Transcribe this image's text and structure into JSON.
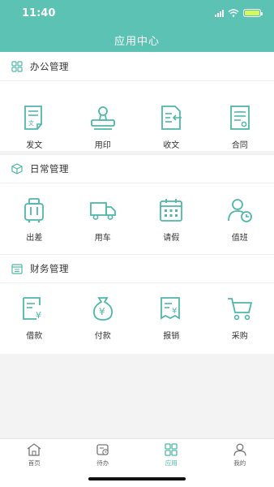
{
  "status_bar": {
    "time": "11:40"
  },
  "header": {
    "title": "应用中心"
  },
  "colors": {
    "accent": "#5bc2b4",
    "icon": "#4fb7a9",
    "battery": "#d7f75a"
  },
  "sections": [
    {
      "title": "办公管理",
      "icon": "grid-icon",
      "items": [
        {
          "label": "发文",
          "icon": "document-icon"
        },
        {
          "label": "用印",
          "icon": "stamp-icon"
        },
        {
          "label": "收文",
          "icon": "receive-document-icon"
        },
        {
          "label": "合同",
          "icon": "contract-icon"
        }
      ]
    },
    {
      "title": "日常管理",
      "icon": "cube-icon",
      "items": [
        {
          "label": "出差",
          "icon": "luggage-icon"
        },
        {
          "label": "用车",
          "icon": "truck-icon"
        },
        {
          "label": "请假",
          "icon": "calendar-icon"
        },
        {
          "label": "值班",
          "icon": "user-clock-icon"
        }
      ]
    },
    {
      "title": "财务管理",
      "icon": "calendar-small-icon",
      "items": [
        {
          "label": "借款",
          "icon": "loan-icon"
        },
        {
          "label": "付款",
          "icon": "money-bag-icon"
        },
        {
          "label": "报销",
          "icon": "reimburse-icon"
        },
        {
          "label": "采购",
          "icon": "cart-icon"
        }
      ]
    }
  ],
  "tabbar": {
    "active": "应用",
    "tabs": [
      {
        "label": "首页",
        "icon": "home-icon"
      },
      {
        "label": "待办",
        "icon": "todo-icon"
      },
      {
        "label": "应用",
        "icon": "apps-icon"
      },
      {
        "label": "我的",
        "icon": "profile-icon"
      }
    ]
  }
}
